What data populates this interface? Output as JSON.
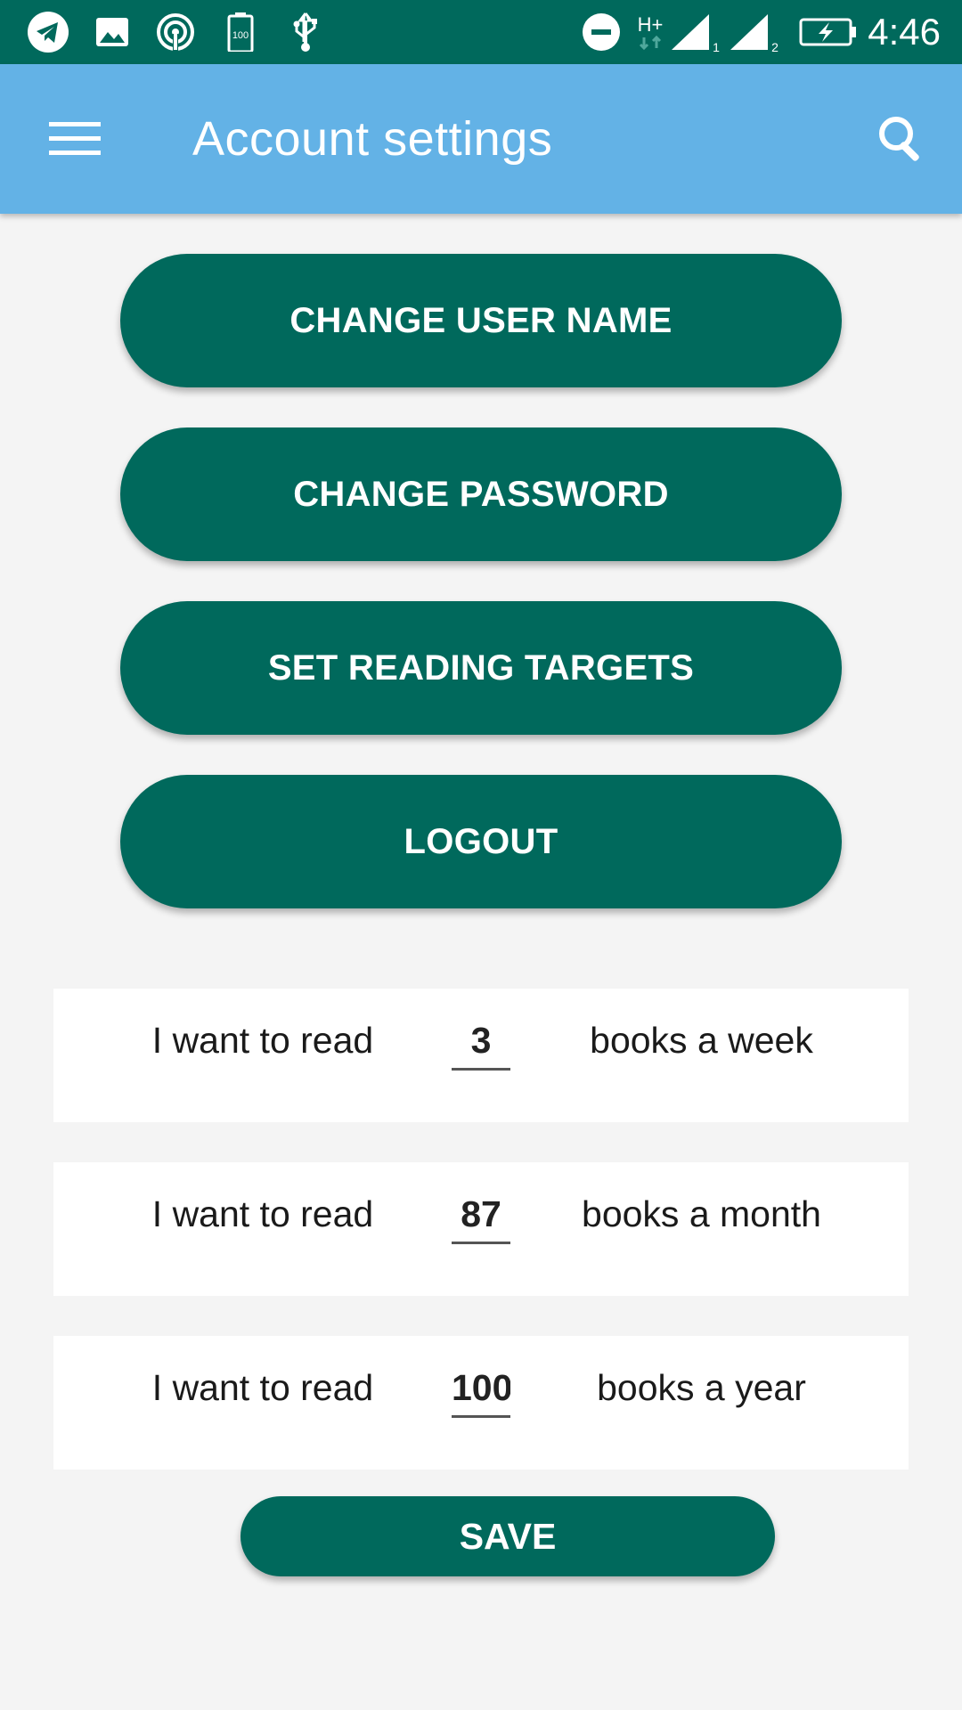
{
  "status_bar": {
    "time": "4:46",
    "icons_left": [
      "telegram-icon",
      "image-icon",
      "hotspot-icon",
      "battery-100-icon",
      "usb-icon"
    ],
    "icons_right": [
      "do-not-disturb-icon",
      "hplus-data-icon",
      "signal-sim1-icon",
      "signal-sim2-icon",
      "battery-charging-icon"
    ],
    "battery_label": "100",
    "network_label": "H+",
    "sim1_label": "1",
    "sim2_label": "2"
  },
  "app_bar": {
    "title": "Account settings",
    "menu_icon": "hamburger-menu-icon",
    "search_icon": "search-icon"
  },
  "buttons": {
    "change_user_name": "CHANGE USER NAME",
    "change_password": "CHANGE PASSWORD",
    "set_reading_targets": "SET READING TARGETS",
    "logout": "LOGOUT"
  },
  "targets": [
    {
      "prefix": "I want to read",
      "value": "3",
      "suffix": "books a week"
    },
    {
      "prefix": "I want to read",
      "value": "87",
      "suffix": "books a month"
    },
    {
      "prefix": "I want to read",
      "value": "100",
      "suffix": "books a year"
    }
  ],
  "save_label": "SAVE",
  "colors": {
    "primary_dark": "#00695c",
    "app_bar": "#63b2e6",
    "background": "#f4f4f4"
  }
}
